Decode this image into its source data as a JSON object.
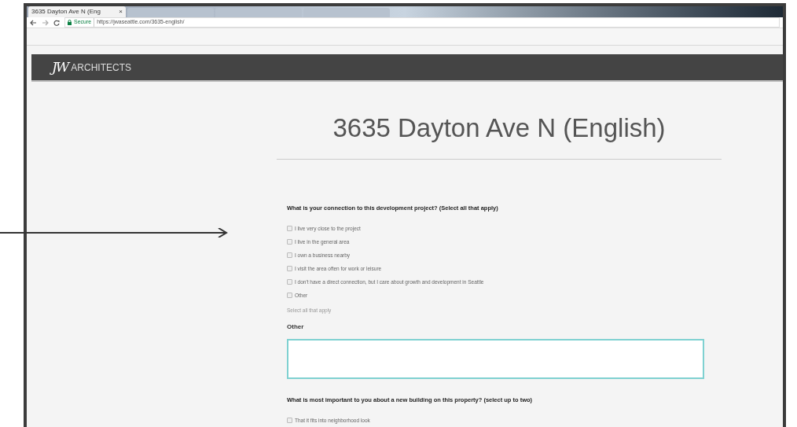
{
  "browser": {
    "tabs": [
      {
        "title": "3635 Dayton Ave N (Eng",
        "close": "×",
        "selected": true
      },
      {
        "selected": false
      },
      {
        "selected": false
      },
      {
        "selected": false
      }
    ],
    "secure_label": "Secure",
    "url": "https://jwaseattle.com/3635-english/"
  },
  "header": {
    "logo": "JW",
    "brand": "ARCHITECTS"
  },
  "page_title": "3635 Dayton Ave N (English)",
  "questions": [
    {
      "kind": "checkboxes",
      "question": "What is your connection to this development project? (Select all that apply)",
      "options": [
        {
          "label": "I live very close to the project",
          "checked": false
        },
        {
          "label": "I live in the general area",
          "checked": false
        },
        {
          "label": "I own a business nearby",
          "checked": false
        },
        {
          "label": "I visit the area often for work or leisure",
          "checked": false
        },
        {
          "label": "I don't have a direct connection, but I care about growth and development in Seattle",
          "checked": false
        },
        {
          "label": "Other",
          "checked": false
        }
      ],
      "hint": "Select all that apply"
    },
    {
      "kind": "textarea",
      "label": "Other"
    },
    {
      "kind": "checkboxes",
      "question": "What is most important to you about a new building on this property? (select up to two)",
      "options": [
        {
          "label": "That it fits into neighborhood look",
          "checked": false
        }
      ]
    }
  ]
}
